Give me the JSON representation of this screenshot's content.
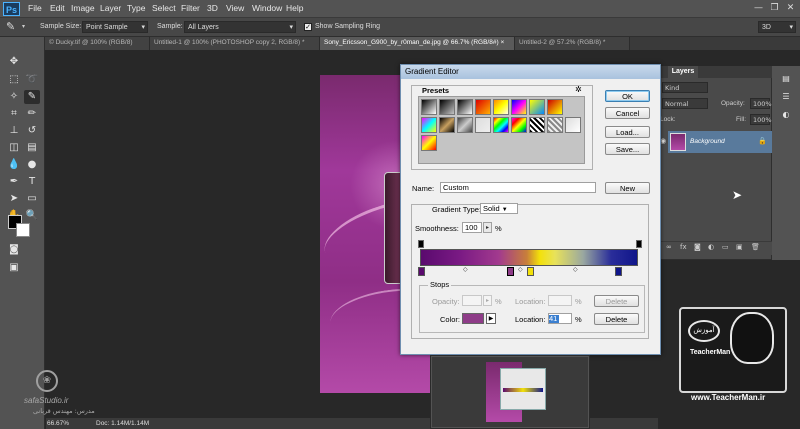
{
  "app": {
    "logo": "Ps"
  },
  "menu": [
    "File",
    "Edit",
    "Image",
    "Layer",
    "Type",
    "Select",
    "Filter",
    "3D",
    "View",
    "Window",
    "Help"
  ],
  "window_controls": {
    "minimize": "—",
    "maximize": "❐",
    "close": "✕"
  },
  "options": {
    "sample_size_label": "Sample Size:",
    "sample_size_value": "Point Sample",
    "sample_label": "Sample:",
    "sample_value": "All Layers",
    "show_ring_label": "Show Sampling Ring",
    "show_ring_checked": "✓",
    "workspace": "3D"
  },
  "tabs": [
    "© Ducky.tif @ 100% (RGB/8)",
    "Untitled-1 @ 100% (PHOTOSHOP copy 2, RGB/8) *",
    "Sony_Ericsson_G900_by_r0man_de.jpg @ 66.7% (RGB/8#)",
    "Untitled-2 @ 57.2% (RGB/8) *"
  ],
  "tab_close": "×",
  "layers_panel": {
    "tab": "Layers",
    "kind": "Kind",
    "blend": "Normal",
    "opacity_label": "Opacity:",
    "opacity_value": "100%",
    "lock_label": "Lock:",
    "fill_label": "Fill:",
    "fill_value": "100%",
    "layer_name": "Background",
    "footer_icons": [
      "∞",
      "fx",
      "◙",
      "◐",
      "▭",
      "▣",
      "🗑"
    ]
  },
  "status": {
    "zoom": "66.67%",
    "doc": "Doc: 1.14M/1.14M"
  },
  "dialog": {
    "title": "Gradient Editor",
    "presets_label": "Presets",
    "presets_menu_icon": "✲",
    "buttons": {
      "ok": "OK",
      "cancel": "Cancel",
      "load": "Load...",
      "save": "Save...",
      "new": "New"
    },
    "name_label": "Name:",
    "name_value": "Custom",
    "gradient_type_label": "Gradient Type:",
    "gradient_type_value": "Solid",
    "smoothness_label": "Smoothness:",
    "smoothness_value": "100",
    "smoothness_unit": "%",
    "stops_label": "Stops",
    "opacity_label": "Opacity:",
    "opacity_unit": "%",
    "location_label": "Location:",
    "location_unit": "%",
    "delete_label": "Delete",
    "color_label": "Color:",
    "color_location_value": "41",
    "selected_color": "#8e3c88",
    "gradient_colors": [
      "#5a0a6e",
      "#a23a8e",
      "#f3e10a",
      "#10168a"
    ]
  },
  "watermarks": {
    "left_site": "safaStudio.ir",
    "left_name": "مدرس: مهندس قربانی",
    "right_badge": "آموزش",
    "right_title": "TeacherMan",
    "right_url": "www.TeacherMan.ir"
  }
}
